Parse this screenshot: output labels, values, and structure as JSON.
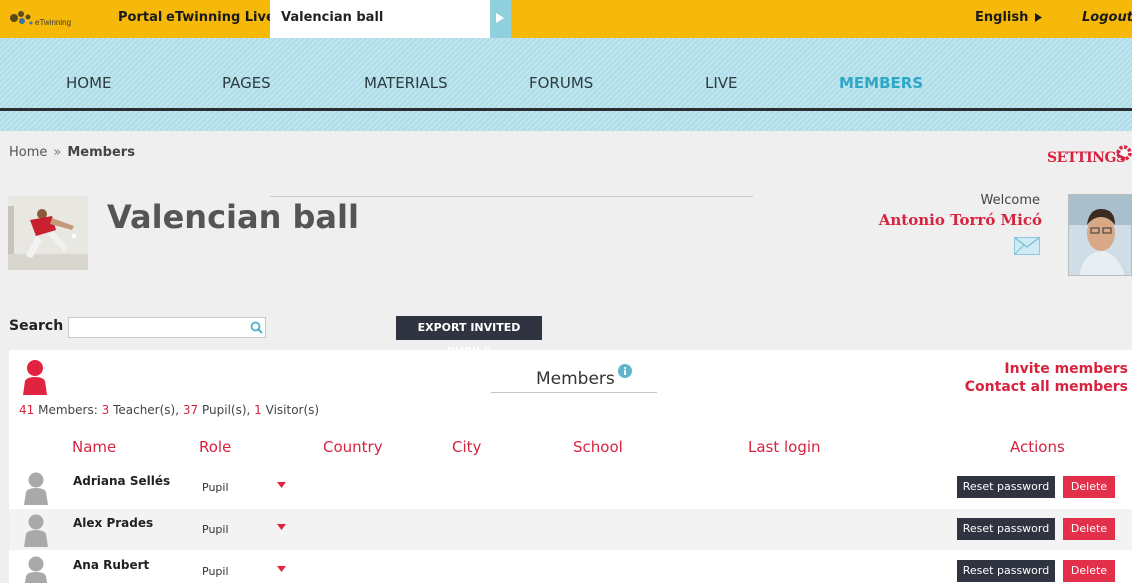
{
  "colors": {
    "topbar": "#f6b90a",
    "accent": "#d8233f",
    "nav_active": "#2fa7c6",
    "dark_button": "#2f3440",
    "delete_button": "#e2304a"
  },
  "topbar": {
    "logo_text": "eTwinning",
    "links": [
      "Portal",
      "eTwinning Live"
    ],
    "project_name": "Valencian ball",
    "language": "English",
    "logout": "Logout"
  },
  "nav": {
    "items": [
      "HOME",
      "PAGES",
      "MATERIALS",
      "FORUMS",
      "LIVE",
      "MEMBERS"
    ],
    "active": "MEMBERS"
  },
  "breadcrumb": {
    "home": "Home",
    "separator": "»",
    "current": "Members"
  },
  "settings_label": "SETTINGS",
  "header": {
    "title": "Valencian ball",
    "welcome": "Welcome",
    "user_name": "Antonio Torró Micó"
  },
  "search": {
    "label": "Search",
    "value": "",
    "placeholder": ""
  },
  "export_button": "EXPORT INVITED PUPILS",
  "members": {
    "title": "Members",
    "invite": "Invite members",
    "contact": "Contact all members",
    "total": "41",
    "total_label": "Members:",
    "teachers": "3",
    "teachers_label": "Teacher(s),",
    "pupils": "37",
    "pupils_label": "Pupil(s),",
    "visitors": "1",
    "visitors_label": "Visitor(s)",
    "columns": [
      "Name",
      "Role",
      "Country",
      "City",
      "School",
      "Last login",
      "Actions"
    ],
    "rows": [
      {
        "name": "Adriana Sellés",
        "role": "Pupil"
      },
      {
        "name": "Alex Prades",
        "role": "Pupil"
      },
      {
        "name": "Ana Rubert",
        "role": "Pupil"
      }
    ],
    "reset_label": "Reset password",
    "delete_label": "Delete"
  }
}
